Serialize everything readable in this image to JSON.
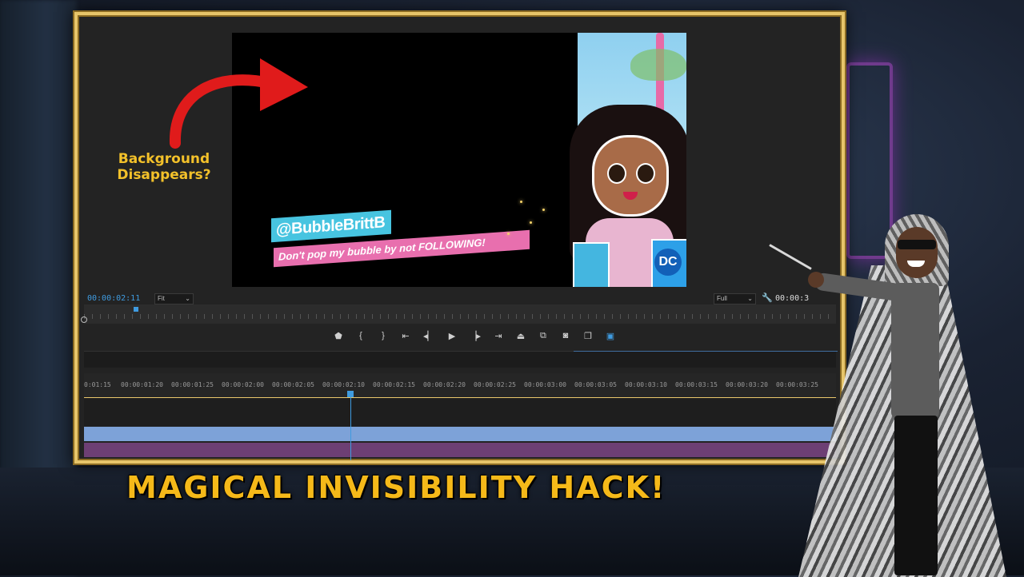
{
  "overlay": {
    "arrow_label": "Background\nDisappears?",
    "headline": "MAGICAL INVISIBILITY HACK!"
  },
  "preview": {
    "handle": "@BubbleBrittB",
    "tagline": "Don't pop my bubble by not FOLLOWING!",
    "bag_logo": "DC"
  },
  "program_monitor": {
    "timecode": "00:00:02:11",
    "fit_option": "Fit",
    "quality_option": "Full",
    "timecode_right": "00:00:3"
  },
  "transport_icons": [
    "marker-icon",
    "in-point-icon",
    "out-point-icon",
    "go-to-in-icon",
    "step-back-icon",
    "play-icon",
    "step-forward-icon",
    "go-to-out-icon",
    "lift-icon",
    "extract-icon",
    "export-frame-icon",
    "comparison-view-icon",
    "vr-view-icon"
  ],
  "timeline": {
    "ruler_labels": [
      "0:01:15",
      "00:00:01:20",
      "00:00:01:25",
      "00:00:02:00",
      "00:00:02:05",
      "00:00:02:10",
      "00:00:02:15",
      "00:00:02:20",
      "00:00:02:25",
      "00:00:03:00",
      "00:00:03:05",
      "00:00:03:10",
      "00:00:03:15",
      "00:00:03:20",
      "00:00:03:25"
    ]
  },
  "colors": {
    "frame_gold": "#e7c56a",
    "headline_yellow": "#f5b919",
    "accent_blue": "#3f9be0",
    "track_blue": "#7da2d8",
    "track_purple": "#6d3f74"
  }
}
